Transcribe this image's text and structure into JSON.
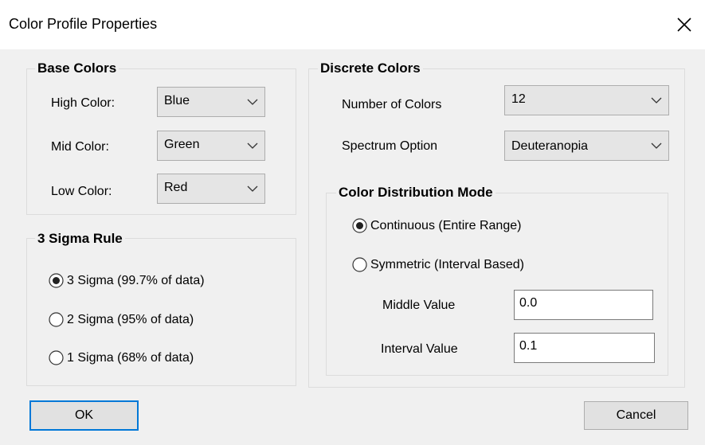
{
  "window": {
    "title": "Color Profile Properties",
    "close_icon": "close-icon"
  },
  "base_colors": {
    "title": "Base Colors",
    "high": {
      "label": "High Color:",
      "value": "Blue"
    },
    "mid": {
      "label": "Mid Color:",
      "value": "Green"
    },
    "low": {
      "label": "Low Color:",
      "value": "Red"
    }
  },
  "sigma": {
    "title": "3 Sigma Rule",
    "options": [
      {
        "label": "3 Sigma (99.7% of data)",
        "selected": true
      },
      {
        "label": "2 Sigma (95% of data)",
        "selected": false
      },
      {
        "label": "1 Sigma (68% of data)",
        "selected": false
      }
    ]
  },
  "discrete": {
    "title": "Discrete Colors",
    "number": {
      "label": "Number of Colors",
      "value": "12"
    },
    "spectrum": {
      "label": "Spectrum Option",
      "value": "Deuteranopia"
    },
    "distribution": {
      "title": "Color Distribution Mode",
      "continuous": {
        "label": "Continuous (Entire Range)",
        "selected": true
      },
      "symmetric": {
        "label": "Symmetric  (Interval Based)",
        "selected": false
      },
      "middle": {
        "label": "Middle Value",
        "value": "0.0"
      },
      "interval": {
        "label": "Interval Value",
        "value": "0.1"
      }
    }
  },
  "buttons": {
    "ok": "OK",
    "cancel": "Cancel"
  },
  "colors": {
    "default_button_border": "#0078d7",
    "background": "#f0f0f0"
  }
}
